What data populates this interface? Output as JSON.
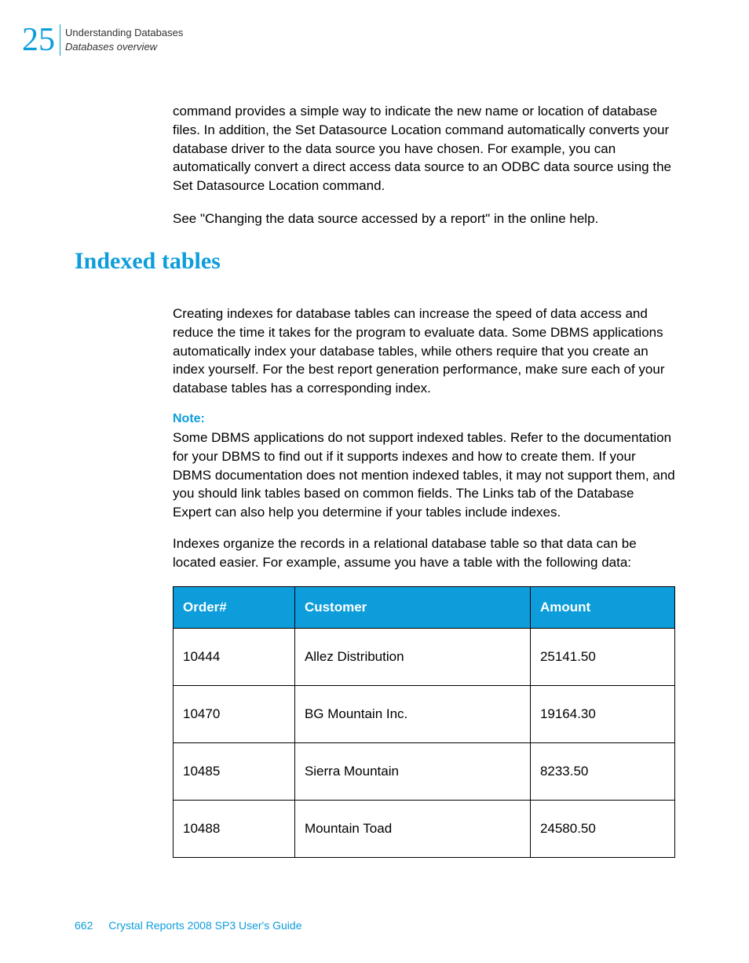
{
  "header": {
    "chapterNumber": "25",
    "chapterTitle": "Understanding Databases",
    "subtitle": "Databases overview"
  },
  "paragraphs": {
    "p1": "command provides a simple way to indicate the new name or location of database files. In addition, the Set Datasource Location command automatically converts your database driver to the data source you have chosen. For example, you can automatically convert a direct access data source to an ODBC data source using the Set Datasource Location command.",
    "p2": "See \"Changing the data source accessed by a report\" in the online help.",
    "p3": "Creating indexes for database tables can increase the speed of data access and reduce the time it takes for the program to evaluate data. Some DBMS applications automatically index your database tables, while others require that you create an index yourself. For the best report generation performance, make sure each of your database tables has a corresponding index.",
    "p4": "Some DBMS applications do not support indexed tables. Refer to the documentation for your DBMS to find out if it supports indexes and how to create them. If your DBMS documentation does not mention indexed tables, it may not support them, and you should link tables based on common fields. The Links tab of the Database Expert can also help you determine if your tables include indexes.",
    "p5": "Indexes organize the records in a relational database table so that data can be located easier. For example, assume you have a table with the following data:"
  },
  "sectionHeading": "Indexed tables",
  "noteLabel": "Note:",
  "table": {
    "headers": {
      "col1": "Order#",
      "col2": "Customer",
      "col3": "Amount"
    },
    "rows": [
      {
        "order": "10444",
        "customer": "Allez Distribution",
        "amount": "25141.50"
      },
      {
        "order": "10470",
        "customer": "BG Mountain Inc.",
        "amount": "19164.30"
      },
      {
        "order": "10485",
        "customer": "Sierra Mountain",
        "amount": "8233.50"
      },
      {
        "order": "10488",
        "customer": "Mountain Toad",
        "amount": "24580.50"
      }
    ]
  },
  "footer": {
    "pageNumber": "662",
    "bookTitle": "Crystal Reports 2008 SP3 User's Guide"
  }
}
